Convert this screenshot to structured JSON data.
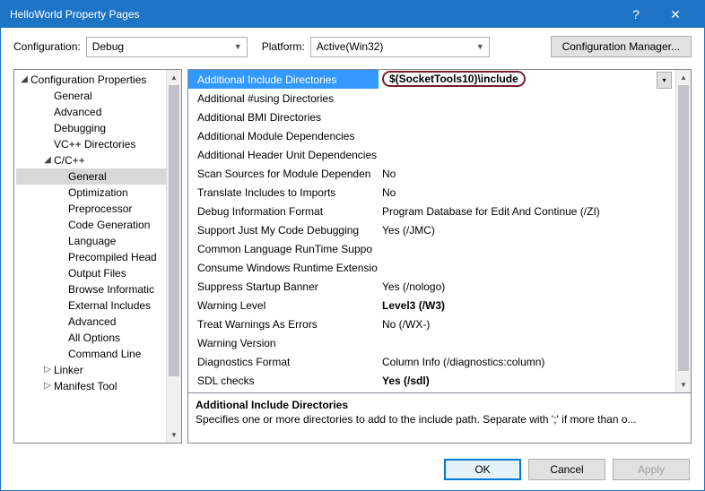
{
  "window": {
    "title": "HelloWorld Property Pages"
  },
  "toolbar": {
    "config_label": "Configuration:",
    "config_value": "Debug",
    "platform_label": "Platform:",
    "platform_value": "Active(Win32)",
    "cfgmgr_label": "Configuration Manager..."
  },
  "tree": {
    "root": "Configuration Properties",
    "level1": [
      "General",
      "Advanced",
      "Debugging",
      "VC++ Directories"
    ],
    "cpp": "C/C++",
    "cpp_children": [
      "General",
      "Optimization",
      "Preprocessor",
      "Code Generation",
      "Language",
      "Precompiled Head",
      "Output Files",
      "Browse Informatic",
      "External Includes",
      "Advanced",
      "All Options",
      "Command Line"
    ],
    "linker": "Linker",
    "manifest": "Manifest Tool"
  },
  "grid": {
    "rows": [
      {
        "name": "Additional Include Directories",
        "value": "$(SocketTools10)\\include",
        "sel": true,
        "hl": true
      },
      {
        "name": "Additional #using Directories",
        "value": ""
      },
      {
        "name": "Additional BMI Directories",
        "value": ""
      },
      {
        "name": "Additional Module Dependencies",
        "value": ""
      },
      {
        "name": "Additional Header Unit Dependencies",
        "value": ""
      },
      {
        "name": "Scan Sources for Module Dependen",
        "value": "No"
      },
      {
        "name": "Translate Includes to Imports",
        "value": "No"
      },
      {
        "name": "Debug Information Format",
        "value": "Program Database for Edit And Continue (/ZI)"
      },
      {
        "name": "Support Just My Code Debugging",
        "value": "Yes (/JMC)"
      },
      {
        "name": "Common Language RunTime Suppo",
        "value": ""
      },
      {
        "name": "Consume Windows Runtime Extensio",
        "value": ""
      },
      {
        "name": "Suppress Startup Banner",
        "value": "Yes (/nologo)"
      },
      {
        "name": "Warning Level",
        "value": "Level3 (/W3)",
        "bold": true
      },
      {
        "name": "Treat Warnings As Errors",
        "value": "No (/WX-)"
      },
      {
        "name": "Warning Version",
        "value": ""
      },
      {
        "name": "Diagnostics Format",
        "value": "Column Info (/diagnostics:column)"
      },
      {
        "name": "SDL checks",
        "value": "Yes (/sdl)",
        "bold": true
      }
    ]
  },
  "desc": {
    "heading": "Additional Include Directories",
    "text": "Specifies one or more directories to add to the include path. Separate with ';' if more than o..."
  },
  "buttons": {
    "ok": "OK",
    "cancel": "Cancel",
    "apply": "Apply"
  }
}
